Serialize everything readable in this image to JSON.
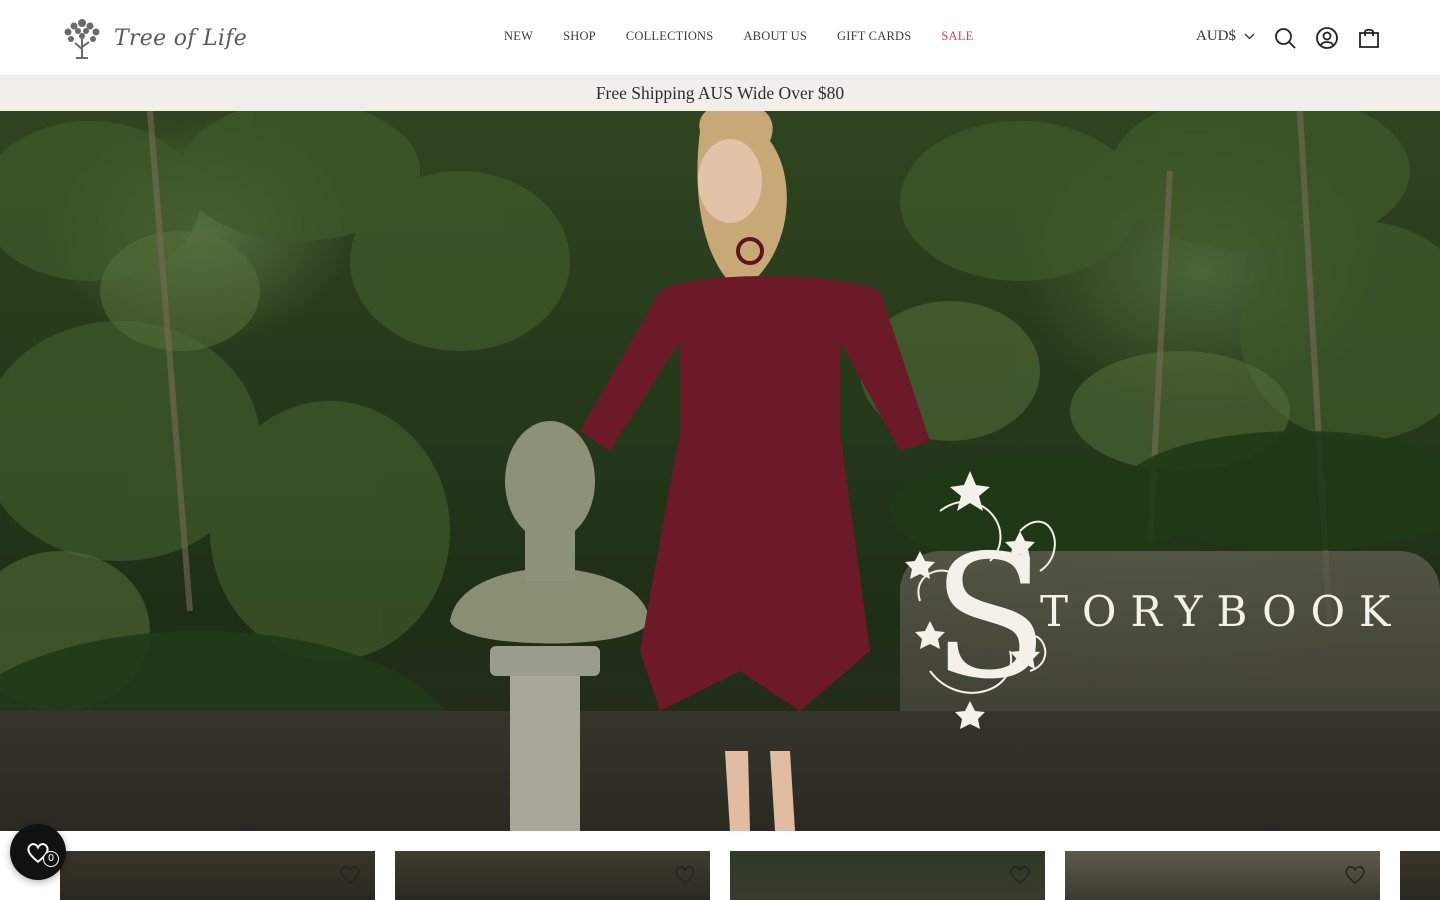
{
  "brand": {
    "name": "Tree of Life"
  },
  "nav": {
    "items": [
      {
        "label": "NEW"
      },
      {
        "label": "SHOP"
      },
      {
        "label": "COLLECTIONS"
      },
      {
        "label": "ABOUT US"
      },
      {
        "label": "GIFT CARDS"
      },
      {
        "label": "SALE"
      }
    ],
    "sale_color": "#d0454c"
  },
  "currency": {
    "label": "AUD$",
    "icon": "chevron-down-icon"
  },
  "header_icons": [
    "search-icon",
    "account-icon",
    "cart-icon"
  ],
  "announcement": {
    "text": "Free Shipping AUS Wide Over $80",
    "bg": "#f1efe9"
  },
  "hero": {
    "title": "STORYBOOK",
    "title_initial": "S",
    "title_rest": "TORYBOOK"
  },
  "wishlist": {
    "count": "0",
    "icon": "heart-icon"
  },
  "products": [
    {
      "icon": "heart-icon"
    },
    {
      "icon": "heart-icon"
    },
    {
      "icon": "heart-icon"
    },
    {
      "icon": "heart-icon"
    },
    {
      "icon": "heart-icon"
    }
  ]
}
